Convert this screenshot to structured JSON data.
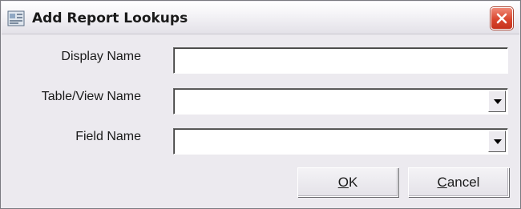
{
  "window": {
    "title": "Add Report Lookups",
    "icon": "app-icon",
    "close_icon": "close-icon"
  },
  "form": {
    "display_name": {
      "label": "Display Name",
      "value": ""
    },
    "table_view_name": {
      "label": "Table/View Name",
      "value": ""
    },
    "field_name": {
      "label": "Field Name",
      "value": ""
    }
  },
  "buttons": {
    "ok": {
      "mnemonic": "O",
      "rest": "K"
    },
    "cancel": {
      "mnemonic": "C",
      "rest": "ancel"
    }
  },
  "colors": {
    "dialog_bg": "#eceaef",
    "close_button": "#d9462e"
  }
}
